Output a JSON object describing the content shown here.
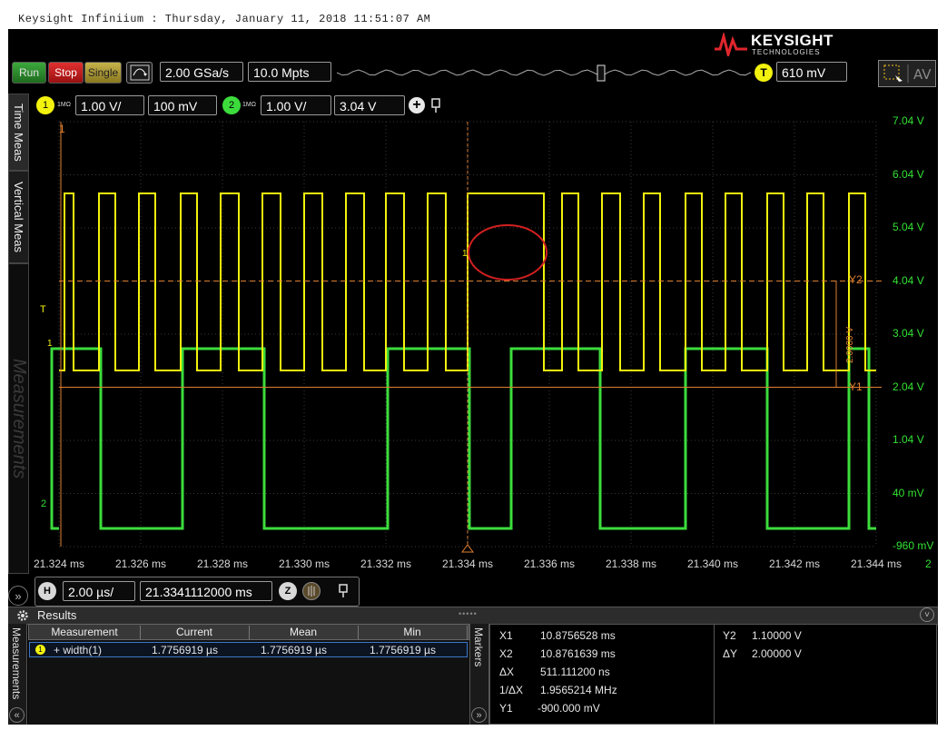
{
  "window_title": "Keysight Infiniium : Thursday, January 11, 2018 11:51:07 AM",
  "brand": {
    "name": "KEYSIGHT",
    "sub": "TECHNOLOGIES",
    "logo_color": "#e0262d"
  },
  "toolbar": {
    "run_label": "Run",
    "stop_label": "Stop",
    "single_label": "Single",
    "sample_rate": "2.00 GSa/s",
    "memory_depth": "10.0 Mpts",
    "trigger_badge": "T",
    "trigger_level": "610 mV"
  },
  "channels": {
    "ch1": {
      "number": "1",
      "impedance": "1MΩ",
      "scale": "1.00 V/",
      "offset": "100 mV",
      "color": "#f2f20e"
    },
    "ch2": {
      "number": "2",
      "impedance": "1MΩ",
      "scale": "1.00 V/",
      "offset": "3.04 V",
      "color": "#3cdc3c"
    },
    "add_icon": "plus-icon"
  },
  "side_tabs": {
    "time_meas": "Time Meas",
    "vertical_meas": "Vertical Meas",
    "measurements": "Measurements"
  },
  "graticule": {
    "y_labels": [
      "7.04 V",
      "6.04 V",
      "5.04 V",
      "4.04 V",
      "3.04 V",
      "2.04 V",
      "1.04 V",
      "40 mV",
      "-960 mV"
    ],
    "x_labels": [
      "21.324 ms",
      "21.326 ms",
      "21.328 ms",
      "21.330 ms",
      "21.332 ms",
      "21.334 ms",
      "21.336 ms",
      "21.338 ms",
      "21.340 ms",
      "21.342 ms",
      "21.344 ms"
    ],
    "marker_y2": "Y2",
    "marker_y1": "Y1",
    "delta_label": "2.0000 V",
    "corner_left": "1",
    "corner_right": "2",
    "trig_marker": "T",
    "ground_marker": "1",
    "ch2_marker": "2",
    "circle_marker": "1"
  },
  "horizontal": {
    "badge": "H",
    "scale": "2.00 µs/",
    "position": "21.3341112000 ms"
  },
  "results": {
    "title": "Results",
    "side_label": "Measurements",
    "markers_label": "Markers",
    "headers": [
      "Measurement",
      "Current",
      "Mean",
      "Min"
    ],
    "row": {
      "channel": "1",
      "name": "+ width(1)",
      "current": "1.7756919 µs",
      "mean": "1.7756919 µs",
      "min": "1.7756919 µs"
    },
    "markers": [
      {
        "label": "X1",
        "value": "10.8756528 ms"
      },
      {
        "label": "X2",
        "value": "10.8761639 ms"
      },
      {
        "label": "ΔX",
        "value": "511.111200 ns"
      },
      {
        "label": "1/ΔX",
        "value": "1.9565214 MHz"
      },
      {
        "label": "Y1",
        "value": "-900.000 mV"
      }
    ],
    "markers_right": [
      {
        "label": "Y2",
        "value": "1.10000 V"
      },
      {
        "label": "ΔY",
        "value": "2.00000 V"
      }
    ]
  }
}
